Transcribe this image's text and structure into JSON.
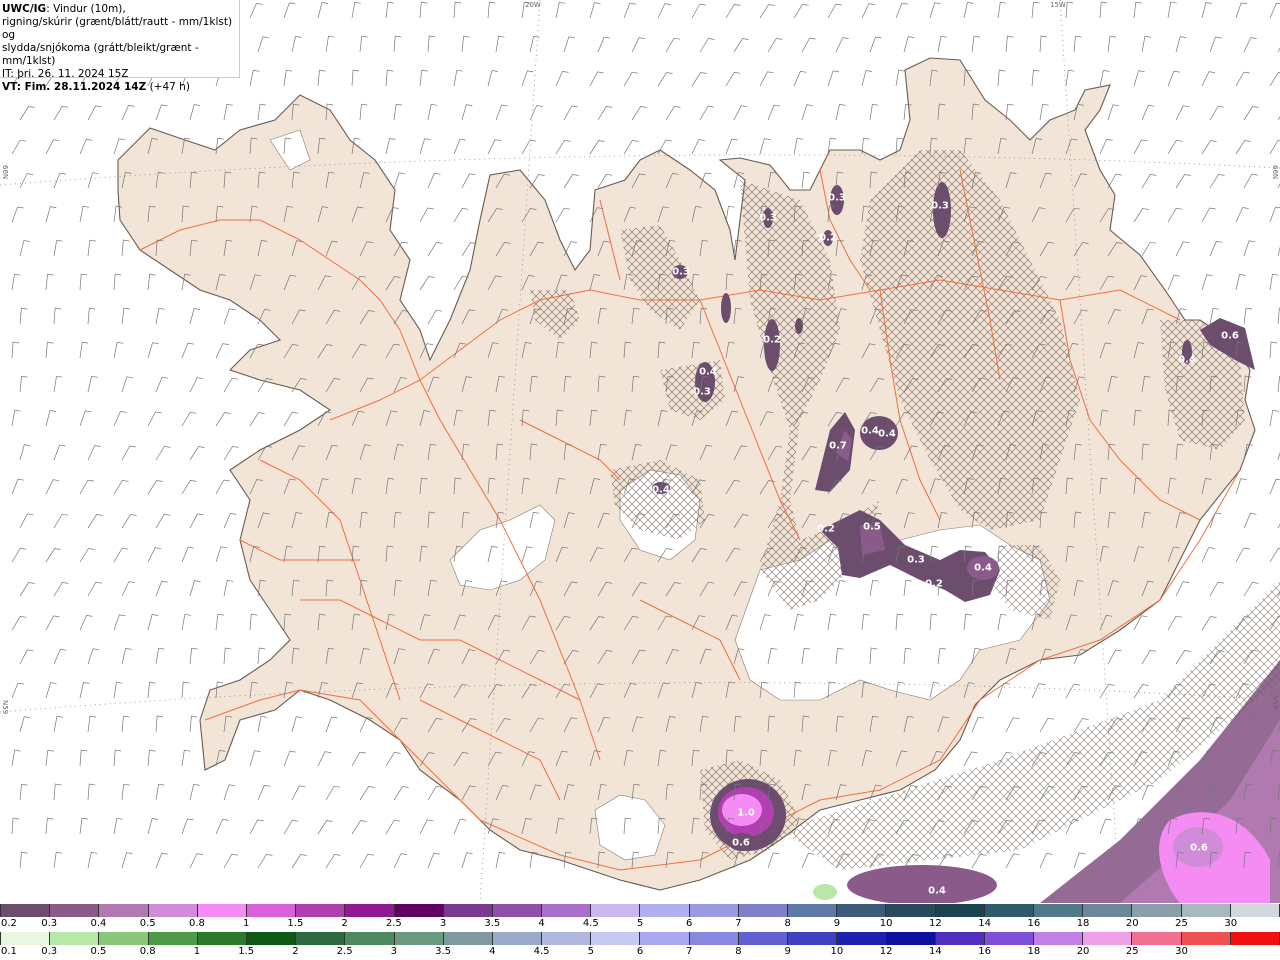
{
  "header": {
    "model": "UWC/IG",
    "line1": ": Vindur (10m),",
    "line2": "rigning/skúrir (grænt/blátt/rautt - mm/1klst) og",
    "line3": "slydda/snjókoma (grátt/bleikt/grænt - mm/1klst)",
    "it_time": "IT: þri. 26. 11. 2024 15Z",
    "vt_time": "VT: Fim. 28.11.2024 14Z",
    "lead": " (+47 h)"
  },
  "grid_labels": {
    "lon_20w": "20W",
    "lon_15w": "15W",
    "lat_66n_left": "66N",
    "lat_66n_right": "66N",
    "lat_65n_left": "N59",
    "lat_65n_right": "N59"
  },
  "precip_labels": [
    "0.3",
    "0.3",
    "0.3",
    "0.2",
    "0.3",
    "0.4",
    "0.3",
    "0.2",
    "0.4",
    "0.4",
    "0.7",
    "0.4",
    "0.2",
    "0.5",
    "0.3",
    "0.2",
    "0.4",
    "0.6",
    "0.4",
    "1.0",
    "0.6",
    "0.6",
    "0.4"
  ],
  "legend_top": {
    "labels": [
      "0.2",
      "0.3",
      "0.4",
      "0.5",
      "0.8",
      "1",
      "1.5",
      "2",
      "2.5",
      "3",
      "3.5",
      "4",
      "4.5",
      "5",
      "6",
      "7",
      "8",
      "9",
      "10",
      "12",
      "14",
      "16",
      "18",
      "20",
      "25",
      "30"
    ],
    "colors": [
      "#6d4d6d",
      "#8a5a8a",
      "#b07ab0",
      "#d08cd8",
      "#f48cf4",
      "#d860d8",
      "#b040b0",
      "#901890",
      "#600060",
      "#7a3a90",
      "#9050a8",
      "#a870c8",
      "#c8b8f0",
      "#b0b0f0",
      "#9a9ae0",
      "#8080c8",
      "#607aa8",
      "#3e5a7a",
      "#284a5a",
      "#1c4450",
      "#2e5a6a",
      "#507a88",
      "#6a8898",
      "#8aa0a8",
      "#a8b8c0",
      "#d0d8dc"
    ]
  },
  "legend_bottom": {
    "labels": [
      "0.1",
      "0.3",
      "0.5",
      "0.8",
      "1",
      "1.5",
      "2",
      "2.5",
      "3",
      "3.5",
      "4",
      "4.5",
      "5",
      "6",
      "7",
      "8",
      "9",
      "10",
      "12",
      "14",
      "16",
      "18",
      "20",
      "25",
      "30"
    ],
    "colors": [
      "#e8f8e0",
      "#b8e8a8",
      "#88c878",
      "#4e9a46",
      "#2a7a2a",
      "#0e5a14",
      "#2e6a40",
      "#4e8a60",
      "#6a9a80",
      "#7e9aa0",
      "#9aaac8",
      "#b0b8e0",
      "#c8c8f4",
      "#a8a8f0",
      "#8888e0",
      "#6060d0",
      "#4040c0",
      "#2020b0",
      "#1010a0",
      "#5030c0",
      "#8050d8",
      "#c080e8",
      "#f0a0e8",
      "#f07090",
      "#f05050",
      "#f01010"
    ]
  },
  "colors": {
    "land": "#f2e4d6",
    "roads": "#f07040",
    "coast": "#6a5a50",
    "sea": "#ffffff"
  }
}
